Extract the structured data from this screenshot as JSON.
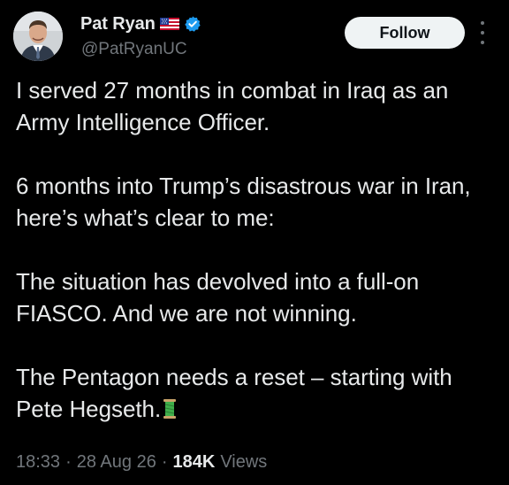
{
  "author": {
    "display_name": "Pat Ryan",
    "handle": "@PatRyanUC",
    "flag_icon": "us-flag-icon",
    "verified_icon": "verified-badge-icon",
    "verified_color": "#1d9bf0"
  },
  "actions": {
    "follow_label": "Follow",
    "more_icon": "more-vertical-icon"
  },
  "tweet": {
    "paragraphs": [
      "I served 27 months in combat in Iraq as an Army Intelligence Officer.",
      "6 months into Trump’s disastrous war in Iran, here’s what’s clear to me:",
      "The situation has devolved into a full-on FIASCO. And we are not winning.",
      "The Pentagon needs a reset – starting with Pete Hegseth."
    ],
    "trailing_emoji_icon": "spool-of-thread-icon"
  },
  "meta": {
    "time": "18:33",
    "date": "28 Aug 26",
    "separator": "·",
    "views_count": "184K",
    "views_label": "Views"
  },
  "colors": {
    "background": "#000000",
    "primary_text": "#e7e9ea",
    "secondary_text": "#71767b",
    "follow_bg": "#eff3f4",
    "follow_text": "#0f1419"
  }
}
